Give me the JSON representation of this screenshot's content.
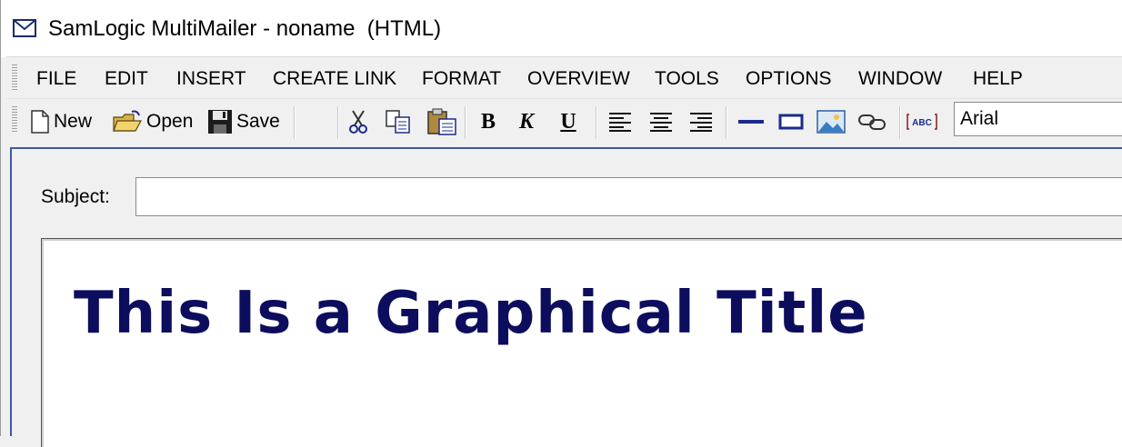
{
  "window": {
    "title": "SamLogic MultiMailer - noname  (HTML)"
  },
  "menu": {
    "items": [
      "FILE",
      "EDIT",
      "INSERT",
      "CREATE LINK",
      "FORMAT",
      "OVERVIEW",
      "TOOLS",
      "OPTIONS",
      "WINDOW",
      "HELP"
    ]
  },
  "toolbar": {
    "new_label": "New",
    "open_label": "Open",
    "save_label": "Save",
    "font_value": "Arial",
    "icons": [
      "new-icon",
      "open-folder-icon",
      "save-disk-icon",
      "cut-icon",
      "copy-icon",
      "paste-icon",
      "bold-icon",
      "italic-icon",
      "underline-icon",
      "align-left-icon",
      "align-center-icon",
      "align-right-icon",
      "horizontal-line-icon",
      "table-icon",
      "image-icon",
      "link-icon",
      "spellcheck-icon"
    ]
  },
  "editor": {
    "subject_label": "Subject:",
    "subject_value": "",
    "graphical_title": "This Is a Graphical Title"
  },
  "colors": {
    "title_text": "#0d0d5e",
    "accent": "#3a5ba0"
  }
}
